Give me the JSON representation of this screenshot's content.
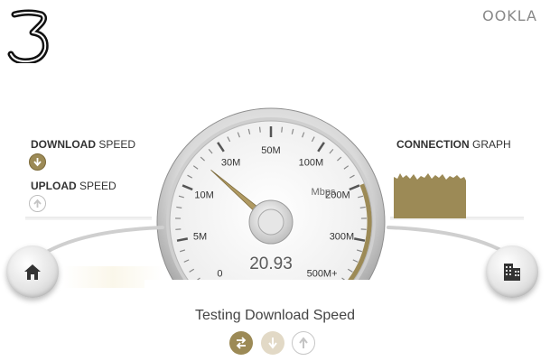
{
  "brand": {
    "logo_text": "3",
    "provider": "OOKLA"
  },
  "left_panel": {
    "download": {
      "bold": "DOWNLOAD",
      "rest": " SPEED",
      "icon": "arrow-down-icon",
      "active": true
    },
    "upload": {
      "bold": "UPLOAD",
      "rest": " SPEED",
      "icon": "arrow-up-icon",
      "active": false
    }
  },
  "right_panel": {
    "graph_label_bold": "CONNECTION",
    "graph_label_rest": " GRAPH"
  },
  "gauge": {
    "unit": "Mbps",
    "reading": "20.93",
    "reading_value": 20.93,
    "ticks": [
      "0",
      "5M",
      "10M",
      "30M",
      "50M",
      "100M",
      "200M",
      "300M",
      "500M+"
    ],
    "progress_fraction": 0.25
  },
  "buttons": {
    "home_icon": "home-icon",
    "server_icon": "building-icon"
  },
  "status": {
    "text": "Testing Download Speed",
    "stages": [
      {
        "name": "ping",
        "icon": "transfer-arrows-icon",
        "state": "done"
      },
      {
        "name": "download",
        "icon": "arrow-down-icon",
        "state": "active"
      },
      {
        "name": "upload",
        "icon": "arrow-up-icon",
        "state": "pending"
      }
    ]
  },
  "colors": {
    "accent_gold": "#9c8a56",
    "needle_gold": "#b09a62",
    "text": "#333333"
  }
}
